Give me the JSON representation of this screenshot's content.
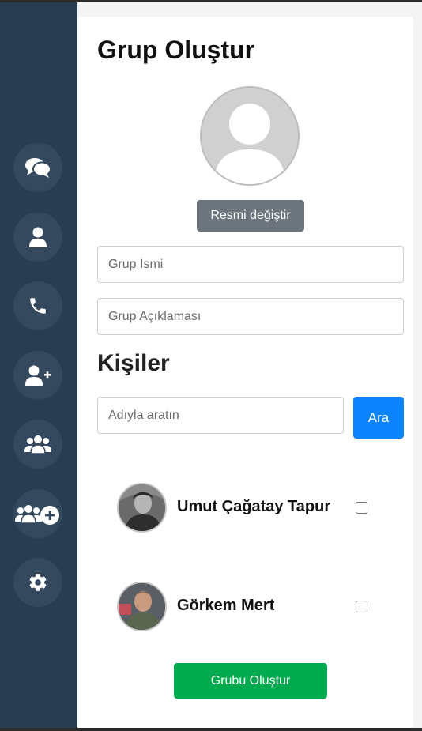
{
  "sidebar": {
    "items": [
      {
        "icon": "chat-bubbles-icon"
      },
      {
        "icon": "user-icon"
      },
      {
        "icon": "phone-icon"
      },
      {
        "icon": "add-user-icon"
      },
      {
        "icon": "users-group-icon"
      },
      {
        "icon": "add-group-icon"
      },
      {
        "icon": "gear-icon"
      }
    ]
  },
  "form": {
    "title": "Grup Oluştur",
    "change_photo_label": "Resmi değiştir",
    "group_name_placeholder": "Grup İsmi",
    "group_description_placeholder": "Grup Açıklaması"
  },
  "contacts_section": {
    "title": "Kişiler",
    "search_placeholder": "Adıyla aratın",
    "search_button": "Ara",
    "contacts": [
      {
        "name": "Umut Çağatay Tapur",
        "checked": false
      },
      {
        "name": "Görkem Mert",
        "checked": false
      }
    ]
  },
  "create_button": "Grubu Oluştur",
  "colors": {
    "sidebar_bg": "#283d52",
    "nav_button_bg": "#34495e",
    "primary": "#0d84ff",
    "success": "#00aa4f",
    "secondary": "#6c757d"
  }
}
